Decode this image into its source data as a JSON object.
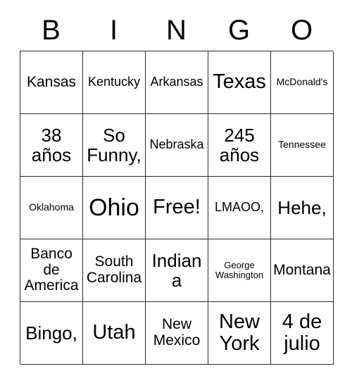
{
  "card": {
    "header_letters": [
      "B",
      "I",
      "N",
      "G",
      "O"
    ],
    "free_space_label": "Free!",
    "grid": [
      [
        {
          "text": "Kansas",
          "size": "md"
        },
        {
          "text": "Kentucky",
          "size": "sm"
        },
        {
          "text": "Arkansas",
          "size": "sm"
        },
        {
          "text": "Texas",
          "size": "xl"
        },
        {
          "text": "McDonald's",
          "size": "xs"
        }
      ],
      [
        {
          "text": "38 años",
          "size": "lg"
        },
        {
          "text": "So Funny,",
          "size": "lg"
        },
        {
          "text": "Nebraska",
          "size": "sm"
        },
        {
          "text": "245 años",
          "size": "lg"
        },
        {
          "text": "Tennessee",
          "size": "xs"
        }
      ],
      [
        {
          "text": "Oklahoma",
          "size": "xs"
        },
        {
          "text": "Ohio",
          "size": "xxl"
        },
        {
          "text": "Free!",
          "size": "xl"
        },
        {
          "text": "LMAOO,",
          "size": "sm"
        },
        {
          "text": "Hehe,",
          "size": "lg"
        }
      ],
      [
        {
          "text": "Banco de America",
          "size": "md"
        },
        {
          "text": "South Carolina",
          "size": "md"
        },
        {
          "text": "Indiana",
          "size": "lg"
        },
        {
          "text": "George Washington",
          "size": "xxs"
        },
        {
          "text": "Montana",
          "size": "md"
        }
      ],
      [
        {
          "text": "Bingo,",
          "size": "lg"
        },
        {
          "text": "Utah",
          "size": "xl"
        },
        {
          "text": "New Mexico",
          "size": "md"
        },
        {
          "text": "New York",
          "size": "xl"
        },
        {
          "text": "4 de julio",
          "size": "xl"
        }
      ]
    ]
  },
  "colors": {
    "background": "#ffffff",
    "border": "#2b2b2b",
    "text": "#000000"
  }
}
